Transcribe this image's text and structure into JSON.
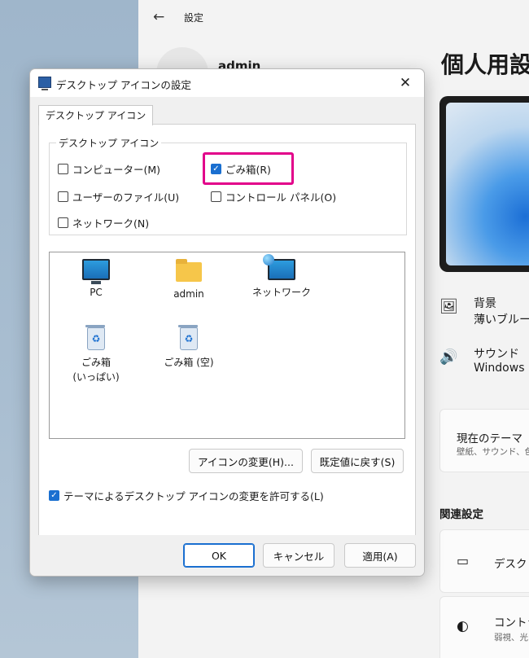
{
  "settings": {
    "back_glyph": "←",
    "title": "設定",
    "user_name": "admin",
    "heading": "個人用設定",
    "rows": [
      {
        "icon": "🖼",
        "title": "背景",
        "subtitle": "薄いブルーム"
      },
      {
        "icon": "🔊",
        "title": "サウンド",
        "subtitle": "Windows"
      }
    ],
    "theme_card": {
      "title": "現在のテーマ",
      "subtitle": "壁紙、サウンド、色"
    },
    "related_heading": "関連設定",
    "related_items": [
      {
        "icon": "▭",
        "label": "デスクトップ"
      },
      {
        "icon": "◐",
        "label": "コントラスト",
        "subtitle": "弱視、光"
      }
    ]
  },
  "dialog": {
    "title": "デスクトップ アイコンの設定",
    "close_glyph": "✕",
    "tab_label": "デスクトップ アイコン",
    "group_label": "デスクトップ アイコン",
    "checkboxes": [
      {
        "label": "コンピューター(M)",
        "checked": false
      },
      {
        "label": "ごみ箱(R)",
        "checked": true
      },
      {
        "label": "ユーザーのファイル(U)",
        "checked": false
      },
      {
        "label": "コントロール パネル(O)",
        "checked": false
      },
      {
        "label": "ネットワーク(N)",
        "checked": false
      }
    ],
    "icons": [
      {
        "label": "PC",
        "icon": "pc-icon"
      },
      {
        "label": "admin",
        "icon": "folder-icon"
      },
      {
        "label": "ネットワーク",
        "icon": "network-icon"
      },
      {
        "label": "ごみ箱\n(いっぱい)",
        "icon": "recycle-bin-full-icon"
      },
      {
        "label": "ごみ箱 (空)",
        "icon": "recycle-bin-empty-icon"
      }
    ],
    "change_icon_button": "アイコンの変更(H)...",
    "restore_default_button": "既定値に戻す(S)",
    "allow_themes_checkbox": {
      "label": "テーマによるデスクトップ アイコンの変更を許可する(L)",
      "checked": true
    },
    "ok_button": "OK",
    "cancel_button": "キャンセル",
    "apply_button": "適用(A)",
    "check_glyph": "✓",
    "accent_color": "#1a6fd0",
    "highlight_color": "#e2008a"
  }
}
